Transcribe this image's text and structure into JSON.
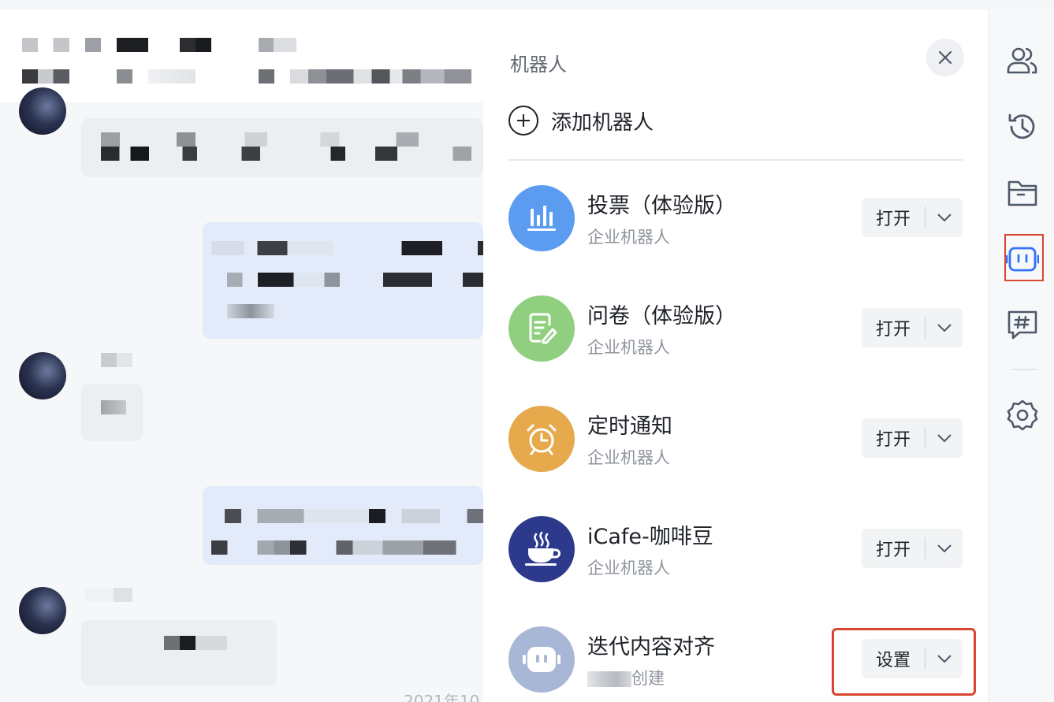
{
  "panel": {
    "title": "机器人",
    "add_label": "添加机器人",
    "bots": [
      {
        "name": "投票（体验版）",
        "subtitle": "企业机器人",
        "button": "打开",
        "icon": "chart-bars-icon",
        "color": "#5b9cf0"
      },
      {
        "name": "问卷（体验版）",
        "subtitle": "企业机器人",
        "button": "打开",
        "icon": "edit-document-icon",
        "color": "#8fcf7f"
      },
      {
        "name": "定时通知",
        "subtitle": "企业机器人",
        "button": "打开",
        "icon": "alarm-clock-icon",
        "color": "#e6a94b"
      },
      {
        "name": "iCafe-咖啡豆",
        "subtitle": "企业机器人",
        "button": "打开",
        "icon": "coffee-cup-icon",
        "color": "#2d3a8c"
      },
      {
        "name": "迭代内容对齐",
        "subtitle": "创建",
        "button": "设置",
        "icon": "robot-face-icon",
        "color": "#a9b7d6"
      }
    ]
  },
  "chat": {
    "date_fragment": "2021年10"
  },
  "sidebar": {
    "items": [
      "members-icon",
      "history-icon",
      "folder-icon",
      "robot-icon",
      "topic-icon",
      "settings-icon"
    ],
    "active": "robot-icon",
    "accent": "#3370ff"
  },
  "highlight_color": "#d9452f"
}
